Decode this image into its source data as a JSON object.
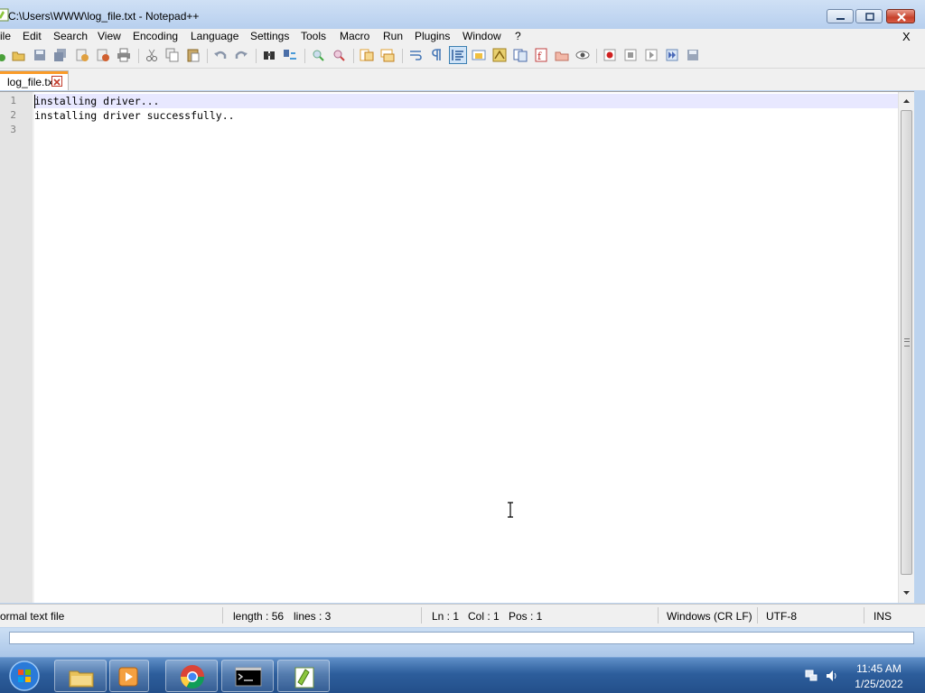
{
  "window": {
    "title": "C:\\Users\\WWW\\log_file.txt - Notepad++"
  },
  "menu": {
    "items": [
      "ile",
      "Edit",
      "Search",
      "View",
      "Encoding",
      "Language",
      "Settings",
      "Tools",
      "Macro",
      "Run",
      "Plugins",
      "Window",
      "?"
    ],
    "close": "X"
  },
  "tabs": [
    {
      "label": "log_file.txt",
      "active": true
    }
  ],
  "editor": {
    "line_numbers": [
      "1",
      "2",
      "3"
    ],
    "lines": [
      "installing driver...",
      "installing driver successfully..",
      ""
    ],
    "current_line": 1
  },
  "status": {
    "filetype": "ormal text file",
    "length": "length : 56",
    "lines": "lines : 3",
    "ln": "Ln : 1",
    "col": "Col : 1",
    "pos": "Pos : 1",
    "eol": "Windows (CR LF)",
    "encoding": "UTF-8",
    "mode": "INS"
  },
  "taskbar": {
    "apps": [
      "folder-icon",
      "media-player-icon",
      "chrome-icon",
      "cmd-icon",
      "notepadpp-icon"
    ],
    "clock_time": "11:45 AM",
    "clock_date": "1/25/2022"
  },
  "colors": {
    "current_line": "#e8e8ff",
    "tab_accent": "#fa9b28",
    "titlebar": "#c4d8f1",
    "taskbar": "#2d5e9c"
  }
}
